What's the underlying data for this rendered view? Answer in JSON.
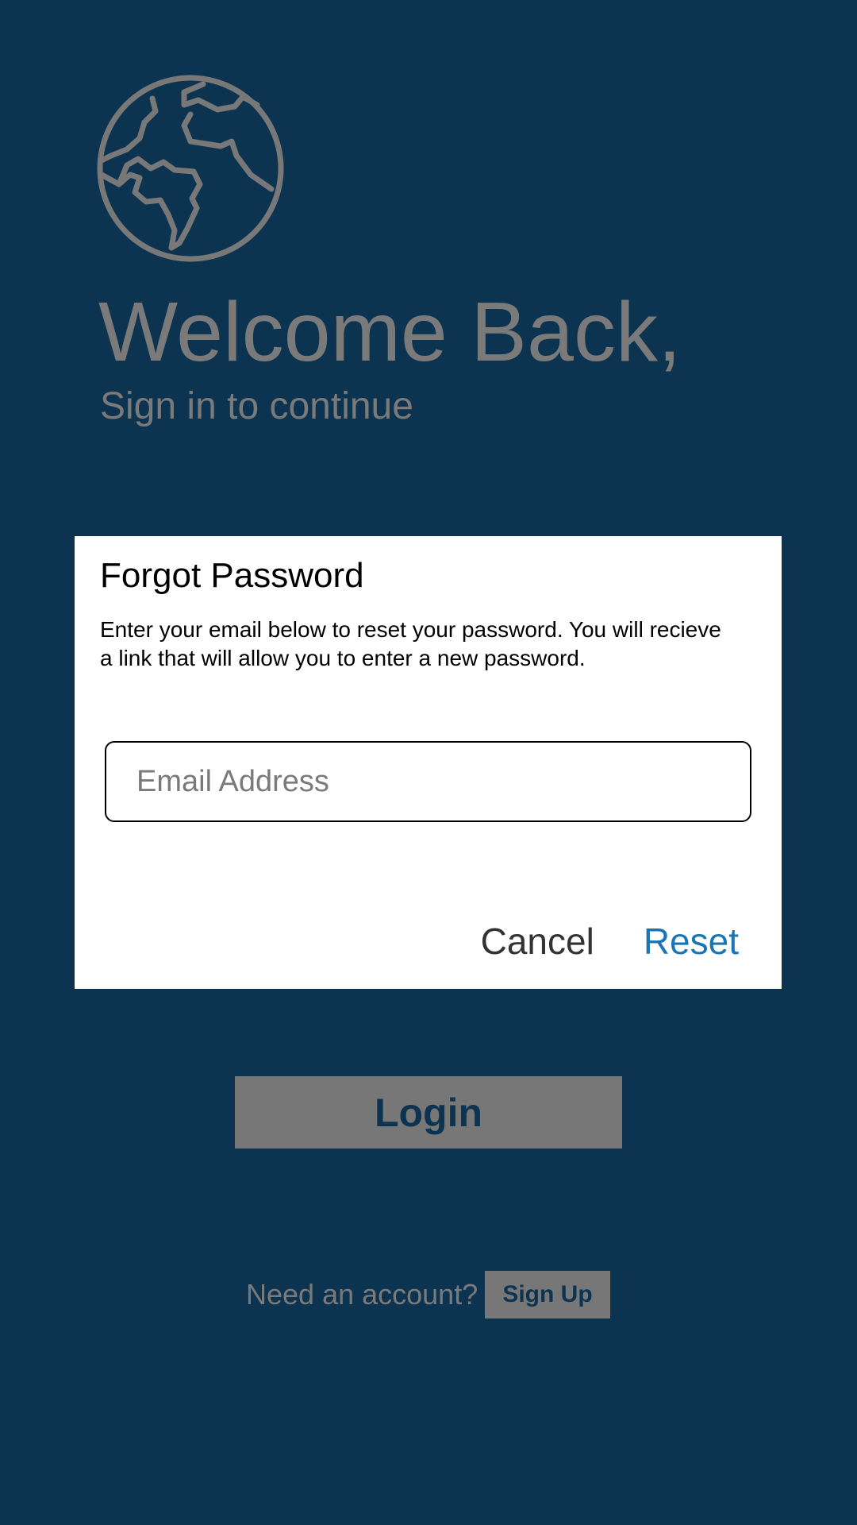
{
  "header": {
    "logo_icon": "globe-icon",
    "title": "Welcome Back,",
    "subtitle": "Sign in to continue"
  },
  "login": {
    "button_label": "Login"
  },
  "signup": {
    "prompt": "Need an account?",
    "button_label": "Sign Up"
  },
  "dialog": {
    "title": "Forgot Password",
    "message": "Enter your email below to reset your password. You will recieve a link that will allow you to enter a new password.",
    "email": {
      "value": "",
      "placeholder": "Email Address"
    },
    "cancel_label": "Cancel",
    "reset_label": "Reset"
  },
  "colors": {
    "background": "#0c3451",
    "muted": "#777777",
    "dialog": "#ffffff",
    "accent": "#1b75b5"
  }
}
